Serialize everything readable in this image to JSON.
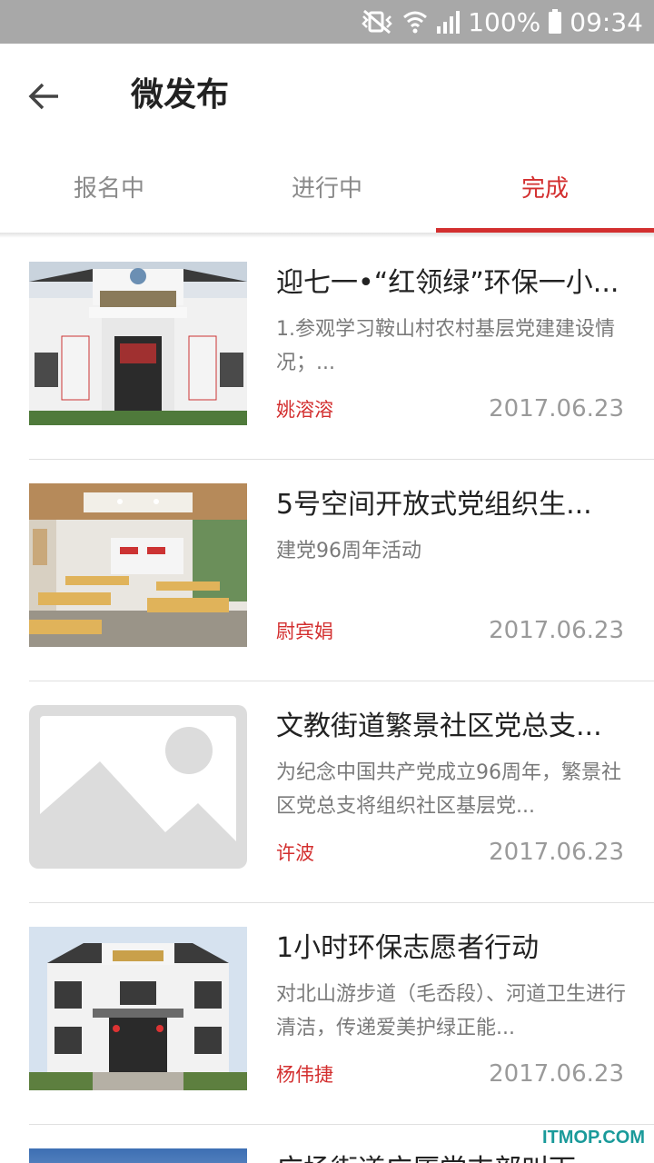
{
  "status_bar": {
    "battery_percent": "100%",
    "time": "09:34"
  },
  "app_bar": {
    "title": "微发布"
  },
  "tabs": [
    {
      "label": "报名中",
      "active": false
    },
    {
      "label": "进行中",
      "active": false
    },
    {
      "label": "完成",
      "active": true
    }
  ],
  "items": [
    {
      "title": "迎七一•“红领绿”环保一小...",
      "desc": "1.参观学习鞍山村农村基层党建建设情况；...",
      "author": "姚溶溶",
      "date": "2017.06.23",
      "image": "building-photo"
    },
    {
      "title": "5号空间开放式党组织生...",
      "desc": "建党96周年活动",
      "author": "尉宾娟",
      "date": "2017.06.23",
      "image": "classroom-photo"
    },
    {
      "title": "文教街道繁景社区党总支...",
      "desc": "为纪念中国共产党成立96周年，繁景社区党总支将组织社区基层党...",
      "author": "许波",
      "date": "2017.06.23",
      "image": "placeholder-image"
    },
    {
      "title": "1小时环保志愿者行动",
      "desc": "对北山游步道（毛岙段）、河道卫生进行清洁，传递爱美护绿正能...",
      "author": "杨伟捷",
      "date": "2017.06.23",
      "image": "hall-photo"
    }
  ],
  "partial_item": {
    "title": "广场街道广厦党支部叫下"
  },
  "watermark": "ITMOP.COM",
  "colors": {
    "accent": "#d32f2f",
    "status_bar": "#a8a8a8"
  }
}
